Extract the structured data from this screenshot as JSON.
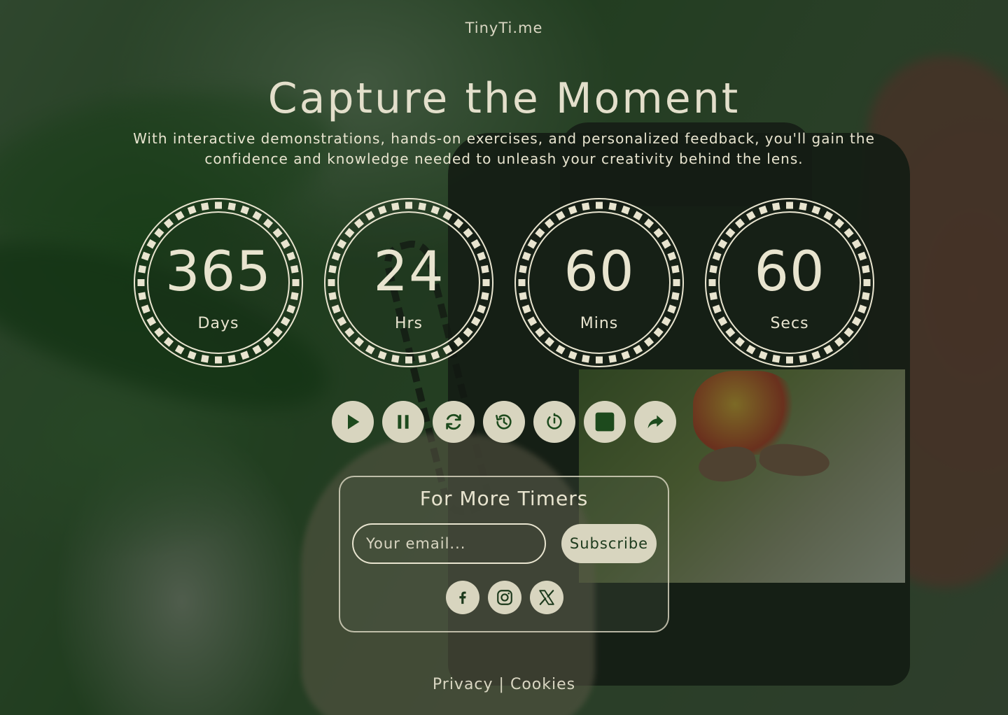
{
  "brand": "TinyTi.me",
  "hero": {
    "title": "Capture the Moment",
    "subtitle": "With interactive demonstrations, hands-on exercises, and personalized feedback, you'll gain the confidence and knowledge needed to unleash your creativity behind the lens."
  },
  "countdown": [
    {
      "value": "365",
      "unit": "Days"
    },
    {
      "value": "24",
      "unit": "Hrs"
    },
    {
      "value": "60",
      "unit": "Mins"
    },
    {
      "value": "60",
      "unit": "Secs"
    }
  ],
  "controls": [
    {
      "name": "play-button",
      "icon": "play-icon"
    },
    {
      "name": "pause-button",
      "icon": "pause-icon"
    },
    {
      "name": "restart-button",
      "icon": "refresh-icon"
    },
    {
      "name": "history-button",
      "icon": "history-icon"
    },
    {
      "name": "timer-button",
      "icon": "timer-icon"
    },
    {
      "name": "stop-button",
      "icon": "stop-icon"
    },
    {
      "name": "share-button",
      "icon": "share-icon"
    }
  ],
  "subscribe": {
    "title": "For More Timers",
    "email_placeholder": "Your email...",
    "button_label": "Subscribe"
  },
  "social": [
    "facebook-icon",
    "instagram-icon",
    "x-icon"
  ],
  "footer": {
    "privacy": "Privacy",
    "separator": "|",
    "cookies": "Cookies"
  },
  "colors": {
    "text": "#e8e4cf",
    "button_bg": "#d8d5bf",
    "icon": "#1d4a1d"
  }
}
